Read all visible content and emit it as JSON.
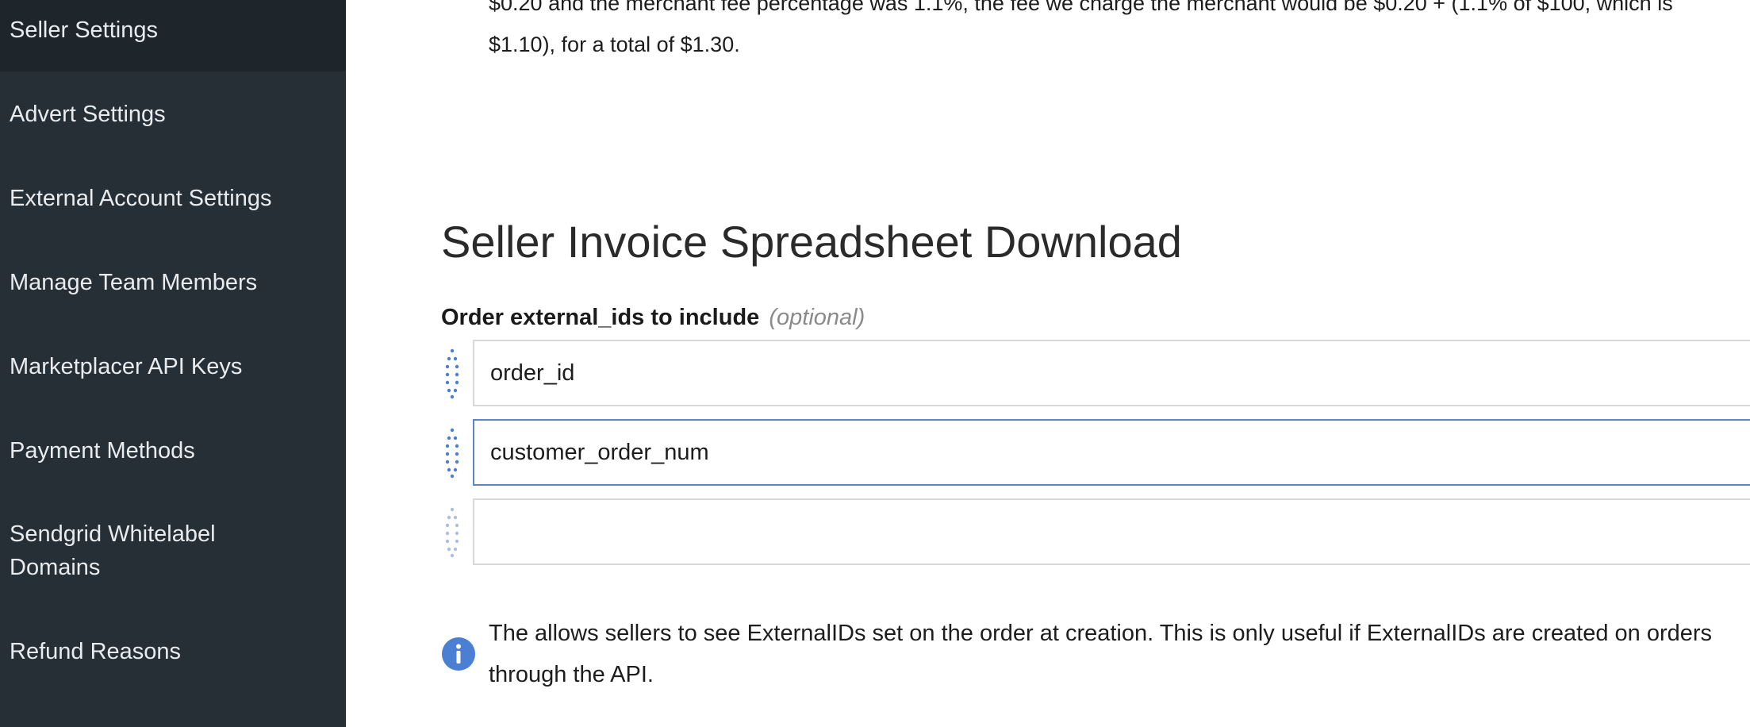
{
  "sidebar": {
    "items": [
      {
        "label": "Seller Settings"
      },
      {
        "label": "Advert Settings"
      },
      {
        "label": "External Account Settings"
      },
      {
        "label": "Manage Team Members"
      },
      {
        "label": "Marketplacer API Keys"
      },
      {
        "label": "Payment Methods"
      },
      {
        "label": "Sendgrid Whitelabel"
      },
      {
        "label": "Domains"
      },
      {
        "label": "Refund Reasons"
      }
    ]
  },
  "main": {
    "intro_line1": "$0.20 and the merchant fee percentage was 1.1%, the fee we charge the merchant would be $0.20 + (1.1% of $100, which is",
    "intro_line2": "$1.10), for a total of $1.30.",
    "section_title": "Seller Invoice Spreadsheet Download",
    "field_label": "Order external_ids to include",
    "field_optional": "(optional)",
    "inputs": [
      {
        "value": "order_id"
      },
      {
        "value": "customer_order_num"
      },
      {
        "value": ""
      }
    ],
    "info_line1": "The allows sellers to see ExternalIDs set on the order at creation. This is only useful if ExternalIDs are created on orders",
    "info_line2": "through the API.",
    "colors": {
      "sidebar_bg": "#262e36",
      "sidebar_active_bg": "#1e252b",
      "accent": "#4a7fd4",
      "focus_border": "#5f86c7"
    }
  }
}
